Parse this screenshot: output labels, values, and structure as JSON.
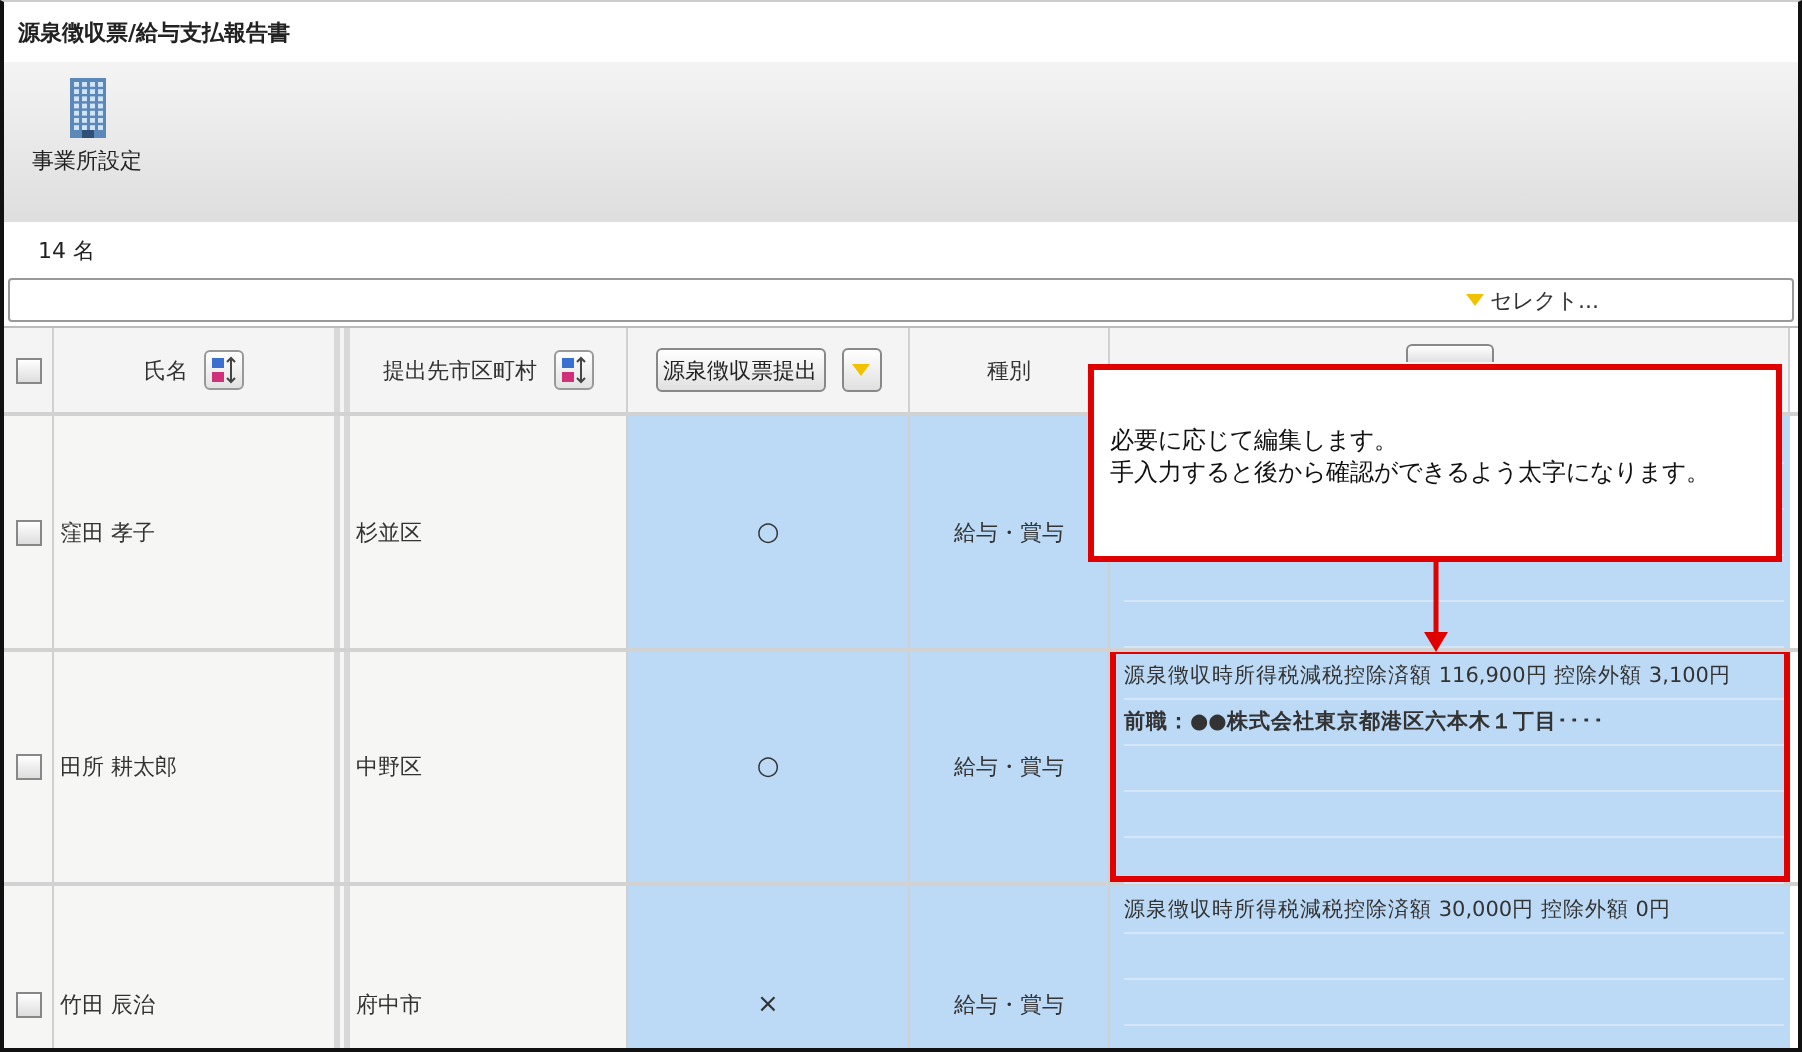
{
  "window": {
    "title": "源泉徴収票/給与支払報告書"
  },
  "toolbar": {
    "items": [
      {
        "label": "事業所設定"
      }
    ]
  },
  "count": "14 名",
  "filter_bar": {
    "label": "セレクト..."
  },
  "table": {
    "header_checkbox": {
      "checked": false
    },
    "columns": [
      {
        "label": "氏名",
        "kind": "sort"
      },
      {
        "label": "提出先市区町村",
        "kind": "sort"
      },
      {
        "label": "源泉徴収票提出",
        "kind": "dropdown"
      },
      {
        "label": "種別",
        "kind": "plain"
      },
      {
        "kind": "covered"
      }
    ],
    "rows": [
      {
        "checked": false,
        "name": "窪田 孝子",
        "city": "杉並区",
        "submitted": "○",
        "type": "給与・賞与",
        "notes": [],
        "highlighted": false
      },
      {
        "checked": false,
        "name": "田所 耕太郎",
        "city": "中野区",
        "submitted": "○",
        "type": "給与・賞与",
        "notes": [
          {
            "text": "源泉徴収時所得税減税控除済額 116,900円  控除外額 3,100円",
            "bold": false
          },
          {
            "text": "前職：●●株式会社東京都港区六本木１丁目････",
            "bold": true
          }
        ],
        "highlighted": true
      },
      {
        "checked": false,
        "name": "竹田 辰治",
        "city": "府中市",
        "submitted": "×",
        "type": "給与・賞与",
        "notes": [
          {
            "text": "源泉徴収時所得税減税控除済額 30,000円  控除外額 0円",
            "bold": false
          }
        ],
        "highlighted": false
      }
    ]
  },
  "callout": {
    "lines": [
      "必要に応じて編集します。",
      "手入力すると後から確認ができるよう太字になります。"
    ]
  }
}
